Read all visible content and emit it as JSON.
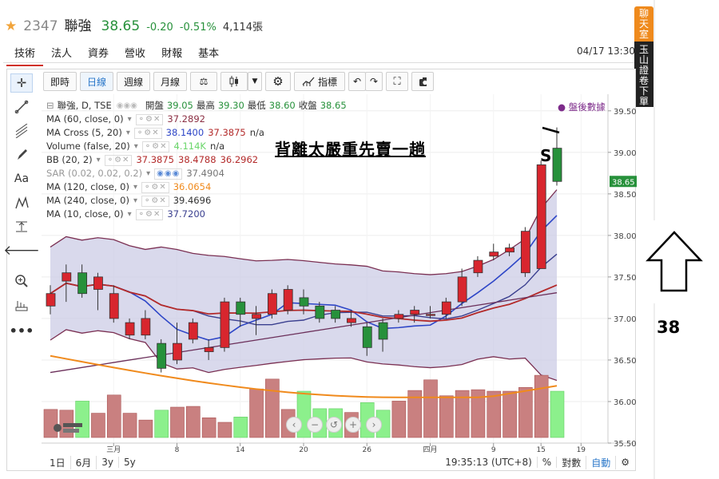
{
  "header": {
    "code": "2347",
    "name": "聯強",
    "price": "38.65",
    "change": "-0.20",
    "change_pct": "-0.51%",
    "volume": "4,114張"
  },
  "tabs": [
    "技術",
    "法人",
    "資券",
    "營收",
    "財報",
    "基本"
  ],
  "active_tab": "技術",
  "datetime": "04/17 13:30",
  "side": {
    "chat": "聊天室",
    "trade": "玉山證卷下單"
  },
  "toolbar": {
    "buttons": [
      "即時",
      "日線",
      "週線",
      "月線"
    ],
    "active": "日線",
    "indicators_label": "指標"
  },
  "legend": {
    "symbol": "聯強, D, TSE",
    "ohlc": {
      "open_label": "開盤",
      "open": "39.05",
      "high_label": "最高",
      "high": "39.30",
      "low_label": "最低",
      "low": "38.60",
      "close_label": "收盤",
      "close": "38.65"
    },
    "after_hours": "盤後數據",
    "indicators": [
      {
        "name": "MA (60, close, 0)",
        "values": [
          "37.2892"
        ],
        "colors": [
          "#8b2f43"
        ]
      },
      {
        "name": "MA Cross (5, 20)",
        "values": [
          "38.1400",
          "37.3875",
          "n/a"
        ],
        "colors": [
          "#2e46c7",
          "#b32a2a",
          "#333333"
        ]
      },
      {
        "name": "Volume (false, 20)",
        "values": [
          "4.114K",
          "n/a"
        ],
        "colors": [
          "#6ad66a",
          "#333333"
        ]
      },
      {
        "name": "BB (20, 2)",
        "values": [
          "37.3875",
          "38.4788",
          "36.2962"
        ],
        "colors": [
          "#b32a2a",
          "#b32a2a",
          "#b32a2a"
        ]
      },
      {
        "name": "SAR (0.02, 0.02, 0.2)",
        "values": [
          "37.4904"
        ],
        "colors": [
          "#777777"
        ]
      },
      {
        "name": "MA (120, close, 0)",
        "values": [
          "36.0654"
        ],
        "colors": [
          "#f08a1c"
        ]
      },
      {
        "name": "MA (240, close, 0)",
        "values": [
          "39.4696"
        ],
        "colors": [
          "#333333"
        ]
      },
      {
        "name": "MA (10, close, 0)",
        "values": [
          "37.7200"
        ],
        "colors": [
          "#3a3f8f"
        ]
      }
    ]
  },
  "annotation": {
    "headline": "背離太嚴重先賣一趟",
    "mark": "S",
    "arrow_label": "38"
  },
  "chart_data": {
    "type": "candlestick",
    "y_ticks": [
      "39.50",
      "39.00",
      "38.50",
      "38.00",
      "37.50",
      "37.00",
      "36.50",
      "36.00",
      "35.50"
    ],
    "last_price_tag": "38.65",
    "x_ticks": [
      "三月",
      "8",
      "14",
      "20",
      "26",
      "四月",
      "9",
      "15",
      "19"
    ],
    "ylim": [
      35.5,
      39.7
    ],
    "candles": [
      {
        "o": 37.15,
        "c": 37.3,
        "h": 37.4,
        "l": 37.05
      },
      {
        "o": 37.45,
        "c": 37.55,
        "h": 37.65,
        "l": 37.2
      },
      {
        "o": 37.55,
        "c": 37.3,
        "h": 37.65,
        "l": 37.25
      },
      {
        "o": 37.35,
        "c": 37.5,
        "h": 37.55,
        "l": 37.1
      },
      {
        "o": 37.0,
        "c": 37.3,
        "h": 37.4,
        "l": 36.95
      },
      {
        "o": 36.8,
        "c": 36.95,
        "h": 37.0,
        "l": 36.75
      },
      {
        "o": 36.8,
        "c": 37.0,
        "h": 37.1,
        "l": 36.75
      },
      {
        "o": 36.7,
        "c": 36.4,
        "h": 36.75,
        "l": 36.35
      },
      {
        "o": 36.5,
        "c": 36.7,
        "h": 36.95,
        "l": 36.45
      },
      {
        "o": 36.75,
        "c": 36.95,
        "h": 37.0,
        "l": 36.7
      },
      {
        "o": 36.6,
        "c": 36.65,
        "h": 36.75,
        "l": 36.5
      },
      {
        "o": 36.65,
        "c": 37.2,
        "h": 37.25,
        "l": 36.6
      },
      {
        "o": 37.2,
        "c": 37.05,
        "h": 37.25,
        "l": 36.9
      },
      {
        "o": 37.0,
        "c": 37.05,
        "h": 37.15,
        "l": 36.8
      },
      {
        "o": 37.05,
        "c": 37.3,
        "h": 37.35,
        "l": 37.0
      },
      {
        "o": 37.1,
        "c": 37.35,
        "h": 37.4,
        "l": 37.05
      },
      {
        "o": 37.25,
        "c": 37.15,
        "h": 37.35,
        "l": 37.05
      },
      {
        "o": 37.15,
        "c": 37.0,
        "h": 37.2,
        "l": 36.95
      },
      {
        "o": 37.1,
        "c": 37.0,
        "h": 37.15,
        "l": 36.95
      },
      {
        "o": 36.95,
        "c": 37.0,
        "h": 37.1,
        "l": 36.9
      },
      {
        "o": 36.9,
        "c": 36.65,
        "h": 36.95,
        "l": 36.55
      },
      {
        "o": 36.95,
        "c": 36.75,
        "h": 37.0,
        "l": 36.6
      },
      {
        "o": 37.0,
        "c": 37.05,
        "h": 37.1,
        "l": 36.95
      },
      {
        "o": 37.05,
        "c": 37.1,
        "h": 37.15,
        "l": 36.95
      },
      {
        "o": 37.05,
        "c": 37.05,
        "h": 37.15,
        "l": 37.0
      },
      {
        "o": 37.05,
        "c": 37.2,
        "h": 37.25,
        "l": 37.0
      },
      {
        "o": 37.2,
        "c": 37.5,
        "h": 37.6,
        "l": 37.15
      },
      {
        "o": 37.55,
        "c": 37.7,
        "h": 37.75,
        "l": 37.5
      },
      {
        "o": 37.75,
        "c": 37.8,
        "h": 37.9,
        "l": 37.7
      },
      {
        "o": 37.8,
        "c": 37.85,
        "h": 37.9,
        "l": 37.75
      },
      {
        "o": 37.55,
        "c": 38.05,
        "h": 38.1,
        "l": 37.5
      },
      {
        "o": 37.6,
        "c": 38.85,
        "h": 38.9,
        "l": 37.6
      },
      {
        "o": 39.05,
        "c": 38.65,
        "h": 39.3,
        "l": 38.6
      }
    ],
    "volume_units": "relative",
    "volumes": [
      0.37,
      0.36,
      0.48,
      0.32,
      0.56,
      0.32,
      0.23,
      0.36,
      0.4,
      0.41,
      0.26,
      0.2,
      0.27,
      0.64,
      0.77,
      0.37,
      0.61,
      0.38,
      0.38,
      0.33,
      0.46,
      0.36,
      0.48,
      0.62,
      0.76,
      0.55,
      0.62,
      0.63,
      0.61,
      0.61,
      0.66,
      0.82,
      0.61
    ]
  }
}
